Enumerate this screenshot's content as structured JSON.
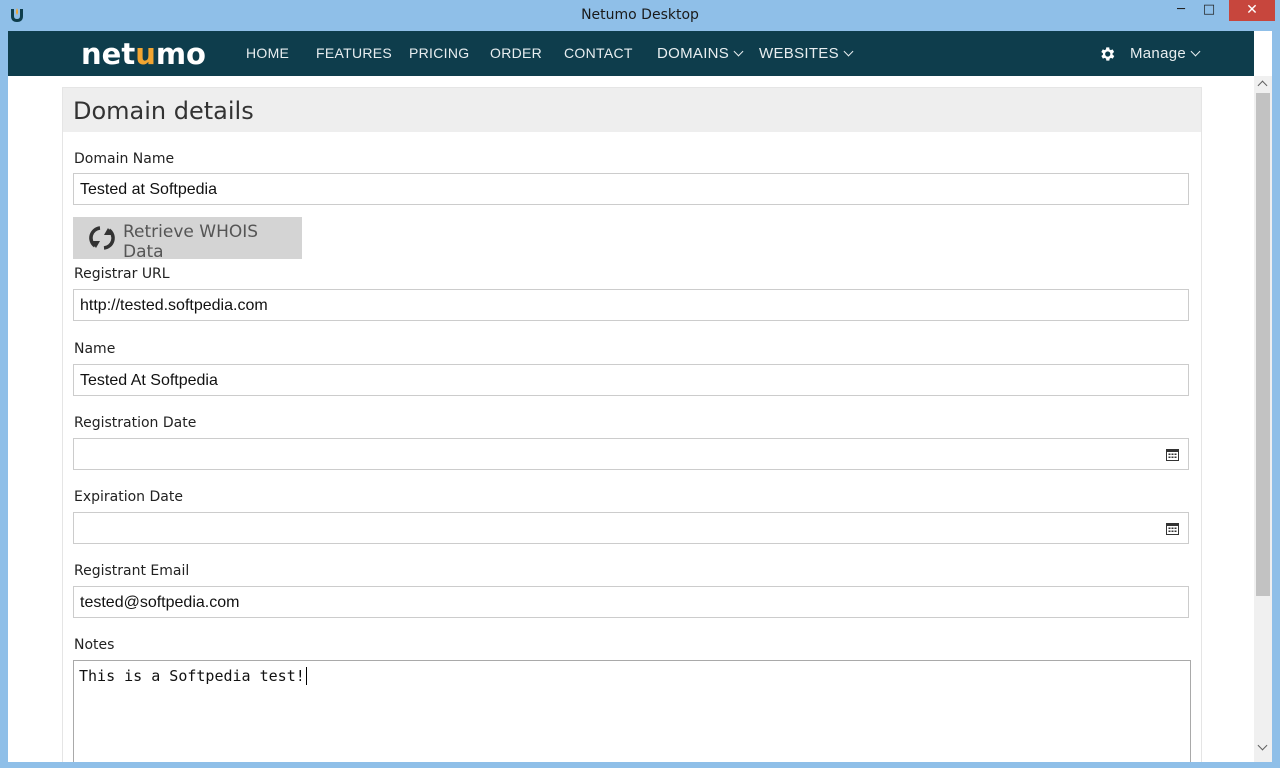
{
  "window": {
    "title": "Netumo Desktop",
    "controls": {
      "minimize": "─",
      "maximize": "□",
      "close": "✕"
    }
  },
  "navbar": {
    "brand_pre": "net",
    "brand_flame": "u",
    "brand_post": "mo",
    "items": [
      {
        "label": "HOME"
      },
      {
        "label": "FEATURES"
      },
      {
        "label": "PRICING"
      },
      {
        "label": "ORDER"
      },
      {
        "label": "CONTACT"
      },
      {
        "label": "DOMAINS"
      },
      {
        "label": "WEBSITES"
      }
    ],
    "manage_label": "Manage"
  },
  "panel": {
    "title": "Domain details",
    "domain_name": {
      "label": "Domain Name",
      "value": "Tested at Softpedia"
    },
    "whois_button": "Retrieve WHOIS Data",
    "registrar_url": {
      "label": "Registrar URL",
      "value": "http://tested.softpedia.com"
    },
    "name": {
      "label": "Name",
      "value": "Tested At Softpedia"
    },
    "registration_date": {
      "label": "Registration Date",
      "value": ""
    },
    "expiration_date": {
      "label": "Expiration Date",
      "value": ""
    },
    "registrant_email": {
      "label": "Registrant Email",
      "value": "tested@softpedia.com"
    },
    "notes": {
      "label": "Notes",
      "value": "This is a Softpedia test!"
    }
  },
  "colors": {
    "navbar": "#0e3d4c",
    "brand_accent": "#f2a531",
    "window_frame": "#8fbfe8",
    "close_button": "#c7463d"
  }
}
